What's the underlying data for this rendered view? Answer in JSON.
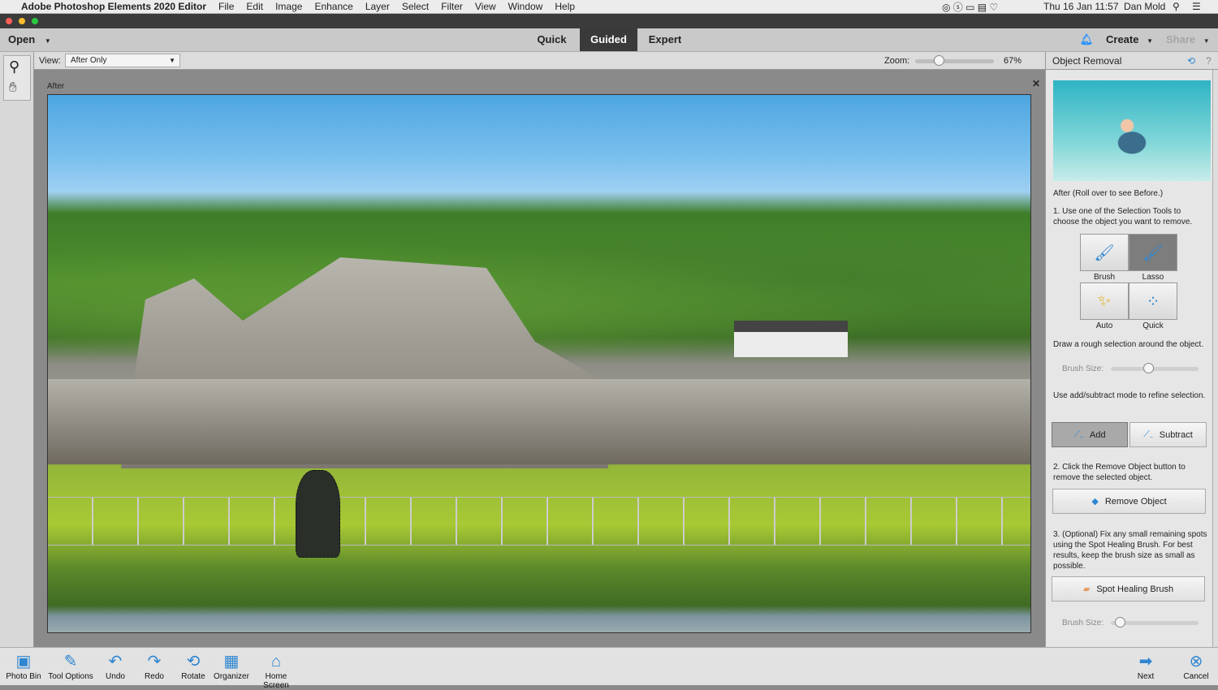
{
  "menubar": {
    "app": "Adobe Photoshop Elements 2020 Editor",
    "items": [
      "File",
      "Edit",
      "Image",
      "Enhance",
      "Layer",
      "Select",
      "Filter",
      "View",
      "Window",
      "Help"
    ],
    "clock": "Thu 16 Jan 11:57",
    "user": "Dan Mold"
  },
  "header": {
    "open": "Open",
    "tabs": [
      "Quick",
      "Guided",
      "Expert"
    ],
    "active_tab": "Guided",
    "create": "Create",
    "share": "Share"
  },
  "options": {
    "view_label": "View:",
    "view_value": "After Only",
    "zoom_label": "Zoom:",
    "zoom_value": "67%",
    "zoom_percent": 67
  },
  "canvas": {
    "label": "After"
  },
  "panel": {
    "title": "Object Removal",
    "preview_caption": "After (Roll over to see Before.)",
    "step1": "1. Use one of the Selection Tools to choose the object you want to remove.",
    "tools": [
      {
        "label": "Brush",
        "selected": false
      },
      {
        "label": "Lasso",
        "selected": true
      },
      {
        "label": "Auto",
        "selected": false
      },
      {
        "label": "Quick",
        "selected": false
      }
    ],
    "hint": "Draw a rough selection around the object.",
    "brush_size_label": "Brush Size:",
    "brush_size_1": 42,
    "refine": "Use add/subtract mode to refine selection.",
    "add": "Add",
    "subtract": "Subtract",
    "mode": "Add",
    "step2": "2. Click the Remove Object button to remove the selected object.",
    "remove": "Remove Object",
    "step3": "3. (Optional) Fix any small remaining spots using the Spot Healing Brush. For best results, keep the brush size as small as possible.",
    "spot": "Spot Healing Brush",
    "brush_size_2": 5
  },
  "bottom": {
    "items": [
      "Photo Bin",
      "Tool Options",
      "Undo",
      "Redo",
      "Rotate",
      "Organizer",
      "Home Screen"
    ],
    "next": "Next",
    "cancel": "Cancel"
  },
  "colors": {
    "accent": "#2f86d1",
    "active_tab_bg": "#3a3a3a"
  }
}
